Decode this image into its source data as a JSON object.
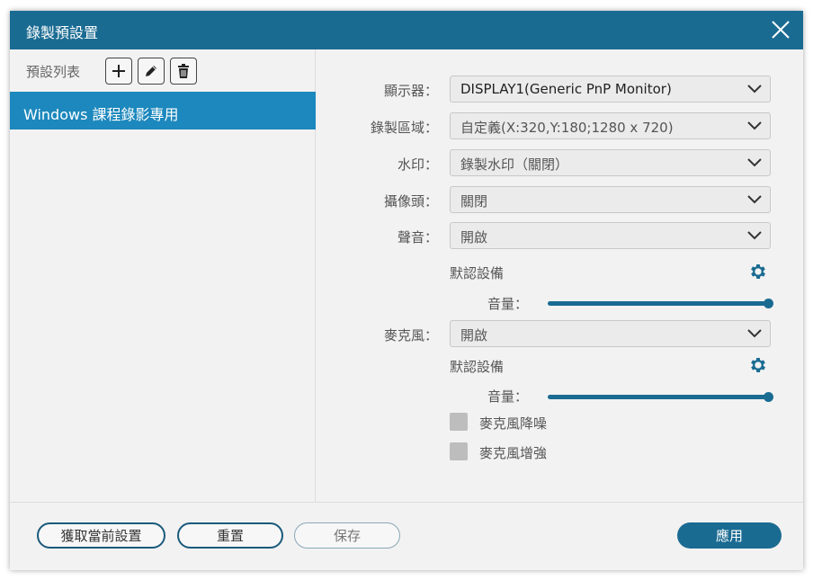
{
  "window": {
    "title": "錄製預設置"
  },
  "preset_panel": {
    "label": "預設列表",
    "items": [
      {
        "label": "Windows 課程錄影專用",
        "selected": true
      }
    ]
  },
  "settings": {
    "display": {
      "label": "顯示器：",
      "value": "DISPLAY1(Generic PnP Monitor)"
    },
    "region": {
      "label": "錄製區域：",
      "value": "自定義(X:320,Y:180;1280 x 720)"
    },
    "watermark": {
      "label": "水印：",
      "value": "錄製水印（關閉）"
    },
    "camera": {
      "label": "攝像頭：",
      "value": "關閉"
    },
    "sound": {
      "label": "聲音：",
      "value": "開啟",
      "device_label": "默認設備",
      "volume_label": "音量：",
      "volume_level": 1.0
    },
    "microphone": {
      "label": "麥克風：",
      "value": "開啟",
      "device_label": "默認設備",
      "volume_label": "音量：",
      "volume_level": 1.0,
      "noise_reduction": {
        "label": "麥克風降噪",
        "checked": false
      },
      "enhance": {
        "label": "麥克風增強",
        "checked": false
      }
    }
  },
  "footer": {
    "get_current_label": "獲取當前設置",
    "reset_label": "重置",
    "save_label": "保存",
    "apply_label": "應用"
  },
  "colors": {
    "accent": "#1a6b92",
    "selected_item": "#1c88bd",
    "background": "#f2f2f2"
  }
}
